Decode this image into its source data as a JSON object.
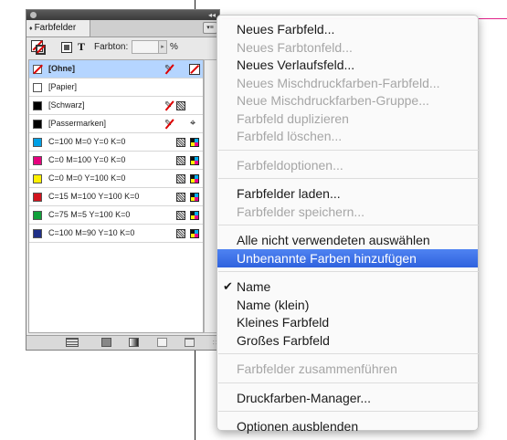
{
  "panel": {
    "tab_label": "Farbfelder",
    "tab_arrows": "♦",
    "collapse_glyph": "◂◂",
    "menu_glyph": "▾≡",
    "toolbar": {
      "text_icon": "T",
      "tint_label": "Farbton:",
      "tint_value": "",
      "tint_percent": "%",
      "stepper_glyph": "▸"
    },
    "swatches": [
      {
        "name": "[Ohne]",
        "color": "none",
        "selected": true,
        "bold": true,
        "icons": [
          "no-edit",
          "nonprint"
        ]
      },
      {
        "name": "[Papier]",
        "color": "#ffffff",
        "selected": false,
        "bold": false,
        "icons": []
      },
      {
        "name": "[Schwarz]",
        "color": "#000000",
        "selected": false,
        "bold": false,
        "icons": [
          "no-edit",
          "process"
        ]
      },
      {
        "name": "[Passermarken]",
        "color": "#000000",
        "selected": false,
        "bold": false,
        "icons": [
          "no-edit",
          "registration"
        ]
      },
      {
        "name": "C=100 M=0 Y=0 K=0",
        "color": "#00a0e6",
        "selected": false,
        "bold": false,
        "icons": [
          "process",
          "cmyk"
        ]
      },
      {
        "name": "C=0 M=100 Y=0 K=0",
        "color": "#e6007e",
        "selected": false,
        "bold": false,
        "icons": [
          "process",
          "cmyk"
        ]
      },
      {
        "name": "C=0 M=0 Y=100 K=0",
        "color": "#fff000",
        "selected": false,
        "bold": false,
        "icons": [
          "process",
          "cmyk"
        ]
      },
      {
        "name": "C=15 M=100 Y=100 K=0",
        "color": "#d2141e",
        "selected": false,
        "bold": false,
        "icons": [
          "process",
          "cmyk"
        ]
      },
      {
        "name": "C=75 M=5 Y=100 K=0",
        "color": "#10a03a",
        "selected": false,
        "bold": false,
        "icons": [
          "process",
          "cmyk"
        ]
      },
      {
        "name": "C=100 M=90 Y=10 K=0",
        "color": "#1f2f88",
        "selected": false,
        "bold": false,
        "icons": [
          "process",
          "cmyk"
        ]
      }
    ],
    "registration_glyph": "⌖",
    "no_edit_glyph": "✎",
    "resize_glyph": "∷"
  },
  "menu": {
    "items": [
      {
        "label": "Neues Farbfeld...",
        "disabled": false
      },
      {
        "label": "Neues Farbtonfeld...",
        "disabled": true
      },
      {
        "label": "Neues Verlaufsfeld...",
        "disabled": false
      },
      {
        "label": "Neues Mischdruckfarben-Farbfeld...",
        "disabled": true
      },
      {
        "label": "Neue Mischdruckfarben-Gruppe...",
        "disabled": true
      },
      {
        "label": "Farbfeld duplizieren",
        "disabled": true
      },
      {
        "label": "Farbfeld löschen...",
        "disabled": true
      },
      {
        "separator": true
      },
      {
        "label": "Farbfeldoptionen...",
        "disabled": true
      },
      {
        "separator": true
      },
      {
        "label": "Farbfelder laden...",
        "disabled": false
      },
      {
        "label": "Farbfelder speichern...",
        "disabled": true
      },
      {
        "separator": true
      },
      {
        "label": "Alle nicht verwendeten auswählen",
        "disabled": false
      },
      {
        "label": "Unbenannte Farben hinzufügen",
        "disabled": false,
        "highlighted": true
      },
      {
        "separator": true
      },
      {
        "label": "Name",
        "disabled": false,
        "checked": true
      },
      {
        "label": "Name (klein)",
        "disabled": false
      },
      {
        "label": "Kleines Farbfeld",
        "disabled": false
      },
      {
        "label": "Großes Farbfeld",
        "disabled": false
      },
      {
        "separator": true
      },
      {
        "label": "Farbfelder zusammenführen",
        "disabled": true
      },
      {
        "separator": true
      },
      {
        "label": "Druckfarben-Manager...",
        "disabled": false
      },
      {
        "separator": true
      },
      {
        "label": "Optionen ausblenden",
        "disabled": false
      }
    ],
    "check_glyph": "✔"
  },
  "colors": {
    "highlight": "#2f62de",
    "guide_pink": "#e0248a",
    "selected_row": "#b5d5ff"
  }
}
